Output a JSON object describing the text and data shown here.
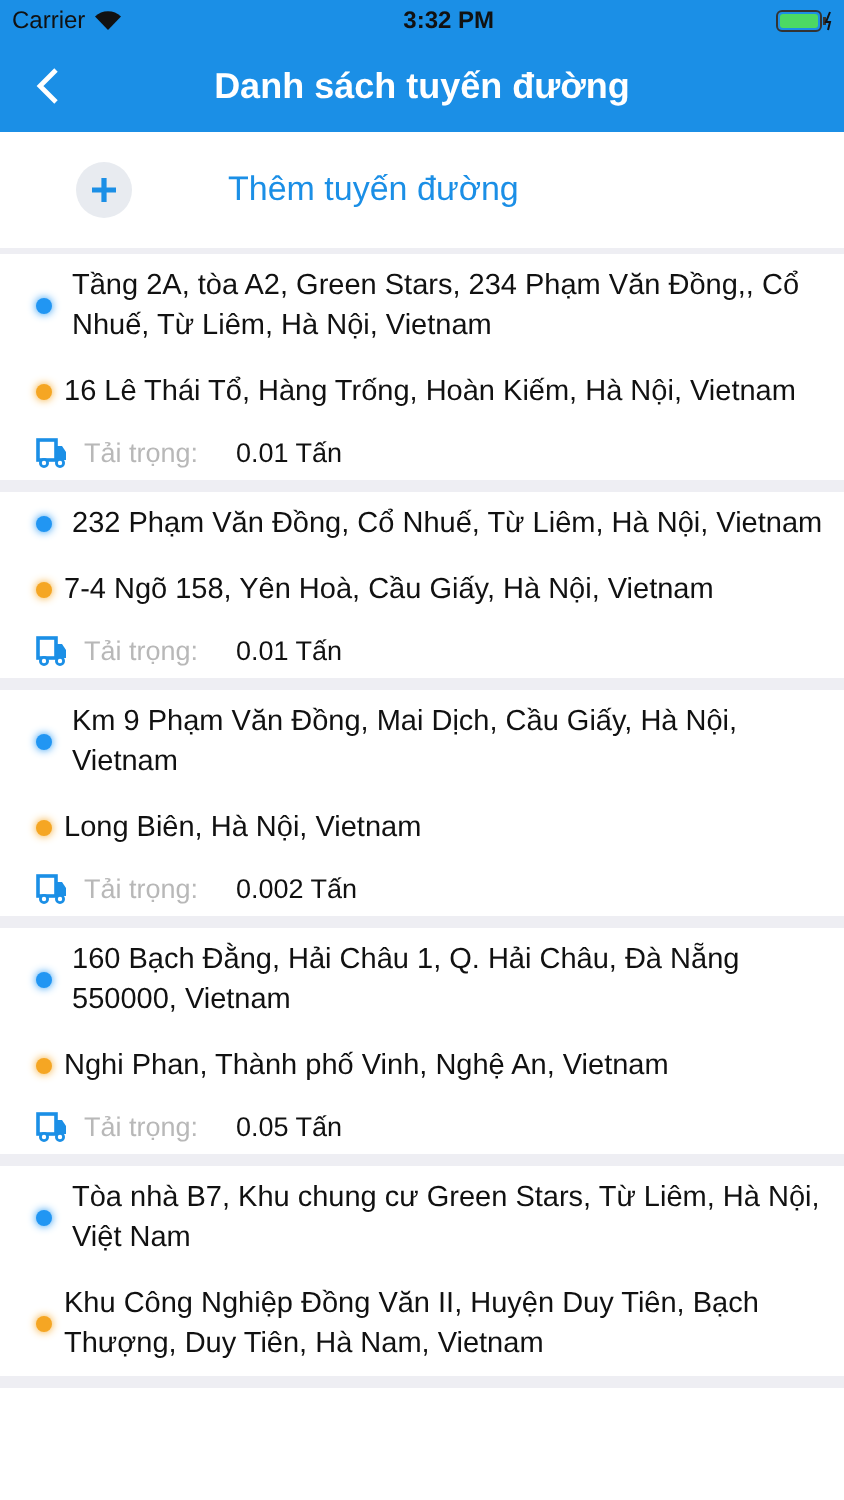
{
  "status_bar": {
    "carrier": "Carrier",
    "time": "3:32 PM"
  },
  "nav": {
    "title": "Danh sách tuyến đường"
  },
  "add_button": {
    "label": "Thêm tuyến đường"
  },
  "routes": [
    {
      "origin": "Tầng 2A, tòa A2, Green Stars, 234 Phạm Văn Đồng,, Cổ Nhuế, Từ Liêm, Hà Nội, Vietnam",
      "destination": "16 Lê Thái Tổ, Hàng Trống, Hoàn Kiếm, Hà Nội, Vietnam",
      "load_label": "Tải trọng:",
      "load": "0.01 Tấn"
    },
    {
      "origin": "232 Phạm Văn Đồng, Cổ Nhuế, Từ Liêm, Hà Nội, Vietnam",
      "destination": "7-4 Ngõ 158, Yên Hoà, Cầu Giấy, Hà Nội, Vietnam",
      "load_label": "Tải trọng:",
      "load": "0.01 Tấn"
    },
    {
      "origin": "Km 9 Phạm Văn Đồng, Mai Dịch, Cầu Giấy, Hà Nội, Vietnam",
      "destination": "Long Biên, Hà Nội, Vietnam",
      "load_label": "Tải trọng:",
      "load": "0.002 Tấn"
    },
    {
      "origin": "160 Bạch Đằng, Hải Châu 1, Q. Hải Châu, Đà Nẵng 550000, Vietnam",
      "destination": "Nghi Phan, Thành phố Vinh, Nghệ An, Vietnam",
      "load_label": "Tải trọng:",
      "load": "0.05 Tấn"
    },
    {
      "origin": "Tòa nhà B7, Khu chung cư Green Stars, Từ Liêm, Hà Nội, Việt Nam",
      "destination": "Khu Công Nghiệp Đồng Văn II, Huyện Duy Tiên, Bạch Thượng, Duy Tiên, Hà Nam, Vietnam"
    }
  ]
}
